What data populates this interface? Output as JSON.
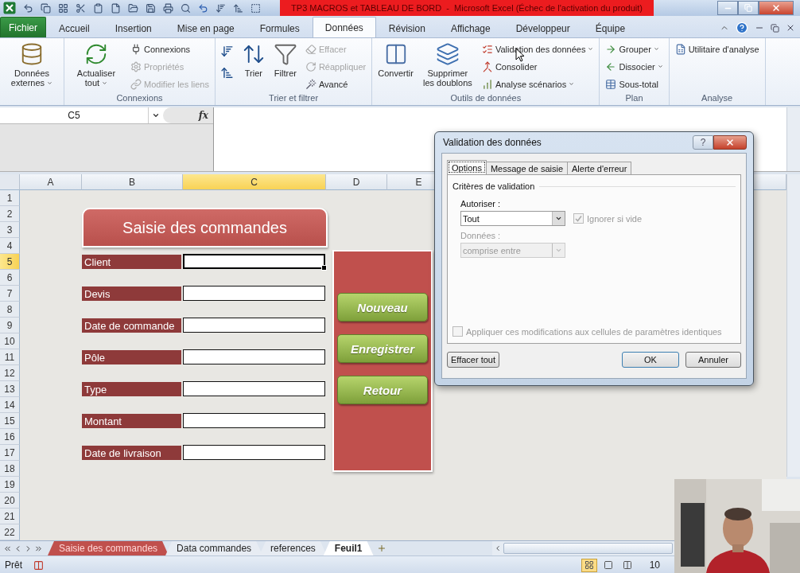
{
  "window": {
    "title": "TP3 MACROS et TABLEAU DE BORD  -  Microsoft Excel (Échec de l'activation du produit)"
  },
  "ribbon_tabs": [
    {
      "label": "Fichier",
      "kind": "file",
      "selected": false
    },
    {
      "label": "Accueil",
      "kind": "tab",
      "selected": false
    },
    {
      "label": "Insertion",
      "kind": "tab",
      "selected": false
    },
    {
      "label": "Mise en page",
      "kind": "tab",
      "selected": false
    },
    {
      "label": "Formules",
      "kind": "tab",
      "selected": false
    },
    {
      "label": "Données",
      "kind": "tab",
      "selected": true
    },
    {
      "label": "Révision",
      "kind": "tab",
      "selected": false
    },
    {
      "label": "Affichage",
      "kind": "tab",
      "selected": false
    },
    {
      "label": "Développeur",
      "kind": "tab",
      "selected": false
    },
    {
      "label": "Équipe",
      "kind": "tab",
      "selected": false
    }
  ],
  "ribbon_groups": [
    {
      "items": [
        {
          "label": "Données externes",
          "kind": "large",
          "dropdown": true,
          "disabled": false
        }
      ]
    },
    {
      "label": "Connexions",
      "items": [
        {
          "label": "Actualiser tout",
          "kind": "large",
          "dropdown": true,
          "disabled": false
        },
        {
          "label": "Connexions",
          "kind": "small",
          "dropdown": false,
          "disabled": false
        },
        {
          "label": "Propriétés",
          "kind": "small",
          "dropdown": false,
          "disabled": true
        },
        {
          "label": "Modifier les liens",
          "kind": "small",
          "dropdown": false,
          "disabled": true
        }
      ]
    },
    {
      "label": "Trier et filtrer",
      "items": [
        {
          "kind": "icon",
          "disabled": false
        },
        {
          "kind": "icon",
          "disabled": false
        },
        {
          "label": "Trier",
          "kind": "large",
          "dropdown": false,
          "disabled": false
        },
        {
          "label": "Filtrer",
          "kind": "large",
          "dropdown": false,
          "disabled": false
        },
        {
          "label": "Effacer",
          "kind": "small",
          "dropdown": false,
          "disabled": true
        },
        {
          "label": "Réappliquer",
          "kind": "small",
          "dropdown": false,
          "disabled": true
        },
        {
          "label": "Avancé",
          "kind": "small",
          "dropdown": false,
          "disabled": false
        }
      ]
    },
    {
      "label": "Outils de données",
      "items": [
        {
          "label": "Convertir",
          "kind": "large",
          "dropdown": false,
          "disabled": false
        },
        {
          "label": "Supprimer les doublons",
          "kind": "large",
          "dropdown": false,
          "disabled": false
        },
        {
          "label": "Validation des données",
          "kind": "small",
          "dropdown": true,
          "disabled": false
        },
        {
          "label": "Consolider",
          "kind": "small",
          "dropdown": false,
          "disabled": false
        },
        {
          "label": "Analyse scénarios",
          "kind": "small",
          "dropdown": true,
          "disabled": false
        }
      ]
    },
    {
      "label": "Plan",
      "items": [
        {
          "label": "Grouper",
          "kind": "small",
          "dropdown": true,
          "disabled": false
        },
        {
          "label": "Dissocier",
          "kind": "small",
          "dropdown": true,
          "disabled": false
        },
        {
          "label": "Sous-total",
          "kind": "small",
          "dropdown": false,
          "disabled": false
        }
      ]
    },
    {
      "label": "Analyse",
      "items": [
        {
          "label": "Utilitaire d'analyse",
          "kind": "small",
          "dropdown": false,
          "disabled": false
        }
      ]
    }
  ],
  "name_box": {
    "value": "C5"
  },
  "function_label": "fx",
  "sheet": {
    "columns": [
      {
        "label": "A",
        "selected": false
      },
      {
        "label": "B",
        "selected": false
      },
      {
        "label": "C",
        "selected": true
      },
      {
        "label": "D",
        "selected": false
      },
      {
        "label": "E",
        "selected": false
      }
    ],
    "rows": [
      {
        "number": "1",
        "selected": false
      },
      {
        "number": "2",
        "selected": false
      },
      {
        "number": "3",
        "selected": false
      },
      {
        "number": "4",
        "selected": false
      },
      {
        "number": "5",
        "selected": true
      },
      {
        "number": "6",
        "selected": false
      },
      {
        "number": "7",
        "selected": false
      },
      {
        "number": "8",
        "selected": false
      },
      {
        "number": "9",
        "selected": false
      },
      {
        "number": "10",
        "selected": false
      },
      {
        "number": "11",
        "selected": false
      },
      {
        "number": "12",
        "selected": false
      },
      {
        "number": "13",
        "selected": false
      },
      {
        "number": "14",
        "selected": false
      },
      {
        "number": "15",
        "selected": false
      },
      {
        "number": "16",
        "selected": false
      },
      {
        "number": "17",
        "selected": false
      },
      {
        "number": "18",
        "selected": false
      },
      {
        "number": "19",
        "selected": false
      },
      {
        "number": "20",
        "selected": false
      },
      {
        "number": "21",
        "selected": false
      },
      {
        "number": "22",
        "selected": false
      }
    ]
  },
  "form": {
    "title": "Saisie des commandes",
    "fields": [
      {
        "label": "Client"
      },
      {
        "label": "Devis"
      },
      {
        "label": "Date de commande"
      },
      {
        "label": "Pôle"
      },
      {
        "label": "Type"
      },
      {
        "label": "Montant"
      },
      {
        "label": "Date de livraison"
      }
    ],
    "buttons": [
      "Nouveau",
      "Enregistrer",
      "Retour"
    ]
  },
  "dialog": {
    "title": "Validation des données",
    "help_button": "?",
    "tabs": [
      {
        "label": "Options",
        "selected": true
      },
      {
        "label": "Message de saisie",
        "selected": false
      },
      {
        "label": "Alerte d'erreur",
        "selected": false
      }
    ],
    "section": "Critères de validation",
    "allow": {
      "label": "Autoriser :",
      "value": "Tout",
      "disabled": false
    },
    "ignore_blank": {
      "label": "Ignorer si vide",
      "checked": true,
      "disabled": true
    },
    "data": {
      "label": "Données :",
      "value": "comprise entre",
      "disabled": true
    },
    "apply_all": {
      "label": "Appliquer ces modifications aux cellules de paramètres identiques",
      "checked": false,
      "disabled": true
    },
    "buttons": [
      {
        "label": "Effacer tout",
        "kind": "left"
      },
      {
        "label": "OK",
        "kind": "default"
      },
      {
        "label": "Annuler",
        "kind": "normal"
      }
    ]
  },
  "sheet_tabs": [
    {
      "label": "Saisie des commandes",
      "selected": false,
      "color": "#c0504d"
    },
    {
      "label": "Data commandes",
      "selected": false
    },
    {
      "label": "references",
      "selected": false
    },
    {
      "label": "Feuil1",
      "selected": true
    }
  ],
  "status_bar": {
    "status": "Prêt",
    "zoom": "10"
  }
}
